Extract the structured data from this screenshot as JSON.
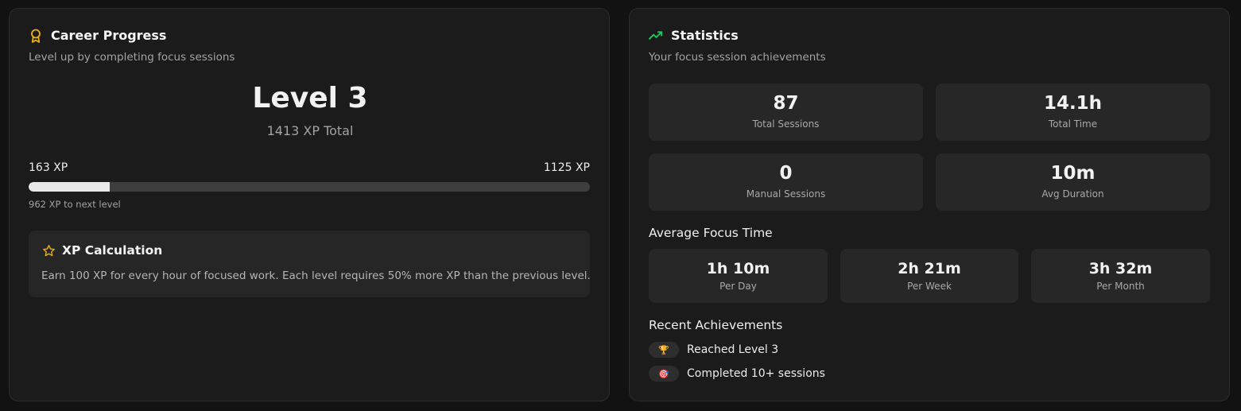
{
  "career": {
    "title": "Career Progress",
    "subtitle": "Level up by completing focus sessions",
    "icon": "award-icon",
    "level_label": "Level 3",
    "xp_total_label": "1413 XP Total",
    "xp_start_label": "163 XP",
    "xp_end_label": "1125 XP",
    "progress_fraction": 0.145,
    "xp_next_label": "962 XP to next level",
    "calc": {
      "icon": "star-icon",
      "title": "XP Calculation",
      "text": "Earn 100 XP for every hour of focused work. Each level requires 50% more XP than the previous level."
    }
  },
  "statistics": {
    "title": "Statistics",
    "subtitle": "Your focus session achievements",
    "icon": "trending-up-icon",
    "accent": "#22c55e",
    "tiles": [
      {
        "value": "87",
        "label": "Total Sessions"
      },
      {
        "value": "14.1h",
        "label": "Total Time"
      },
      {
        "value": "0",
        "label": "Manual Sessions"
      },
      {
        "value": "10m",
        "label": "Avg Duration"
      }
    ],
    "avg_title": "Average Focus Time",
    "avg_tiles": [
      {
        "value": "1h 10m",
        "label": "Per Day"
      },
      {
        "value": "2h 21m",
        "label": "Per Week"
      },
      {
        "value": "3h 32m",
        "label": "Per Month"
      }
    ],
    "achievements_title": "Recent Achievements",
    "achievements": [
      {
        "icon": "trophy-icon",
        "emoji": "🏆",
        "text": "Reached Level 3"
      },
      {
        "icon": "target-icon",
        "emoji": "🎯",
        "text": "Completed 10+ sessions"
      }
    ]
  },
  "colors": {
    "award": "#eab308",
    "star": "#eab308",
    "trend": "#22c55e"
  }
}
